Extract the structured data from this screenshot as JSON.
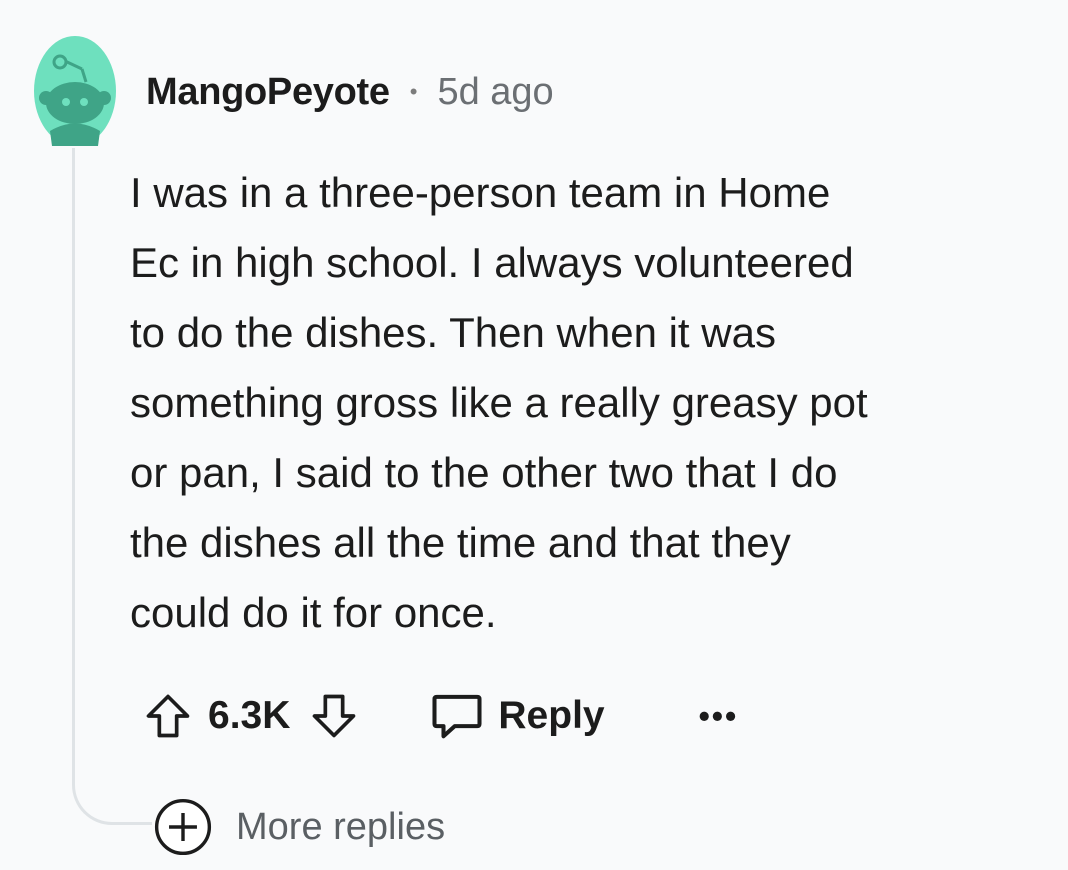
{
  "comment": {
    "username": "MangoPeyote",
    "separator": "•",
    "timestamp": "5d ago",
    "body_lines": [
      "I was in a three-person team in Home",
      "Ec in high school. I always volunteered",
      "to do the dishes. Then when it was",
      "something gross like a really greasy pot",
      "or pan, I said to the other two that I do",
      "the dishes all the time and that they",
      "could do it for once."
    ],
    "score": "6.3K",
    "reply_label": "Reply",
    "overflow_label": "•••"
  },
  "thread": {
    "more_replies_label": "More replies"
  },
  "colors": {
    "avatar_bg": "#6ee0be",
    "avatar_fg": "#3fa487",
    "thread_line": "#dfe3e6"
  }
}
